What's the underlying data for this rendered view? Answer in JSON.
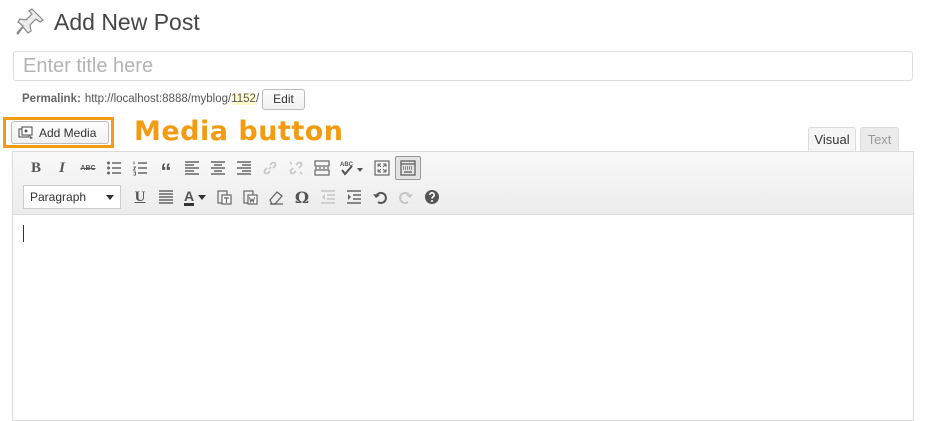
{
  "header": {
    "title": "Add New Post",
    "icon": "pushpin-icon"
  },
  "title_field": {
    "placeholder": "Enter title here",
    "value": ""
  },
  "permalink": {
    "label": "Permalink:",
    "base": "http://localhost:8888/myblog/",
    "slug": "1152",
    "suffix": "/",
    "edit_label": "Edit"
  },
  "media": {
    "button_label": "Add Media",
    "annotation": "Media button",
    "annotation_color": "#f39c12"
  },
  "tabs": [
    {
      "label": "Visual",
      "active": true
    },
    {
      "label": "Text",
      "active": false
    }
  ],
  "toolbar": {
    "row1": [
      "bold",
      "italic",
      "strikethrough",
      "bulleted-list",
      "numbered-list",
      "blockquote",
      "align-left",
      "align-center",
      "align-right",
      "insert-link",
      "remove-link",
      "insert-more",
      "spellcheck",
      "fullscreen",
      "toolbar-toggle"
    ],
    "row2": [
      "paragraph-format",
      "underline",
      "justify",
      "text-color",
      "paste-as-text",
      "paste-from-word",
      "clear-formatting",
      "special-character",
      "outdent",
      "indent",
      "undo",
      "redo",
      "help"
    ],
    "format_value": "Paragraph",
    "bold_glyph": "B",
    "italic_glyph": "I",
    "underline_glyph": "U",
    "text_color_glyph": "A",
    "omega_glyph": "Ω",
    "quote_glyph": "“",
    "abc_glyph": "ABC"
  }
}
